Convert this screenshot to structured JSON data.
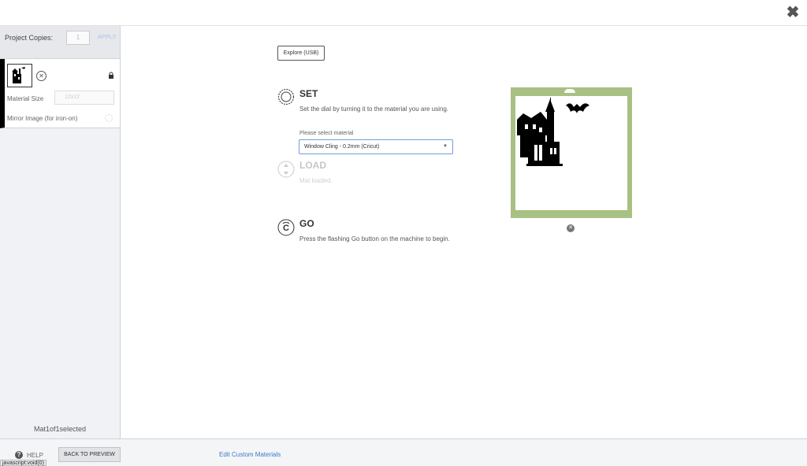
{
  "sidebar": {
    "project_copies_label": "Project Copies:",
    "project_copies_value": "1",
    "apply_label": "APPLY",
    "mat": {
      "material_size_label": "Material Size",
      "material_size_value": "12x12",
      "mirror_label": "Mirror Image (for iron-on)"
    },
    "mat_count": "Mat1of1selected"
  },
  "main": {
    "explore_button": "Explore (USB)",
    "steps": {
      "set": {
        "title": "SET",
        "description": "Set the dial by turning it to the material you are using."
      },
      "load": {
        "title": "LOAD",
        "description": "Mat loaded."
      },
      "go": {
        "title": "GO",
        "description": "Press the flashing Go button on the machine to begin."
      }
    },
    "material_select": {
      "label": "Please select material",
      "value": "Window Cling - 0.2mm (Cricut)"
    }
  },
  "footer": {
    "help_label": "HELP",
    "back_button": "BACK TO PREVIEW",
    "edit_materials_link": "Edit Custom Materials",
    "status_url": "javascript:void(0)"
  },
  "icons": {
    "close": "close-icon",
    "lock": "lock-icon",
    "help": "help-icon",
    "set": "dial-icon",
    "load": "load-arrows-icon",
    "go": "cricut-go-icon"
  },
  "colors": {
    "mat_green": "#a8c083",
    "link_blue": "#3a7bc8",
    "select_border": "#6f9fd6"
  }
}
